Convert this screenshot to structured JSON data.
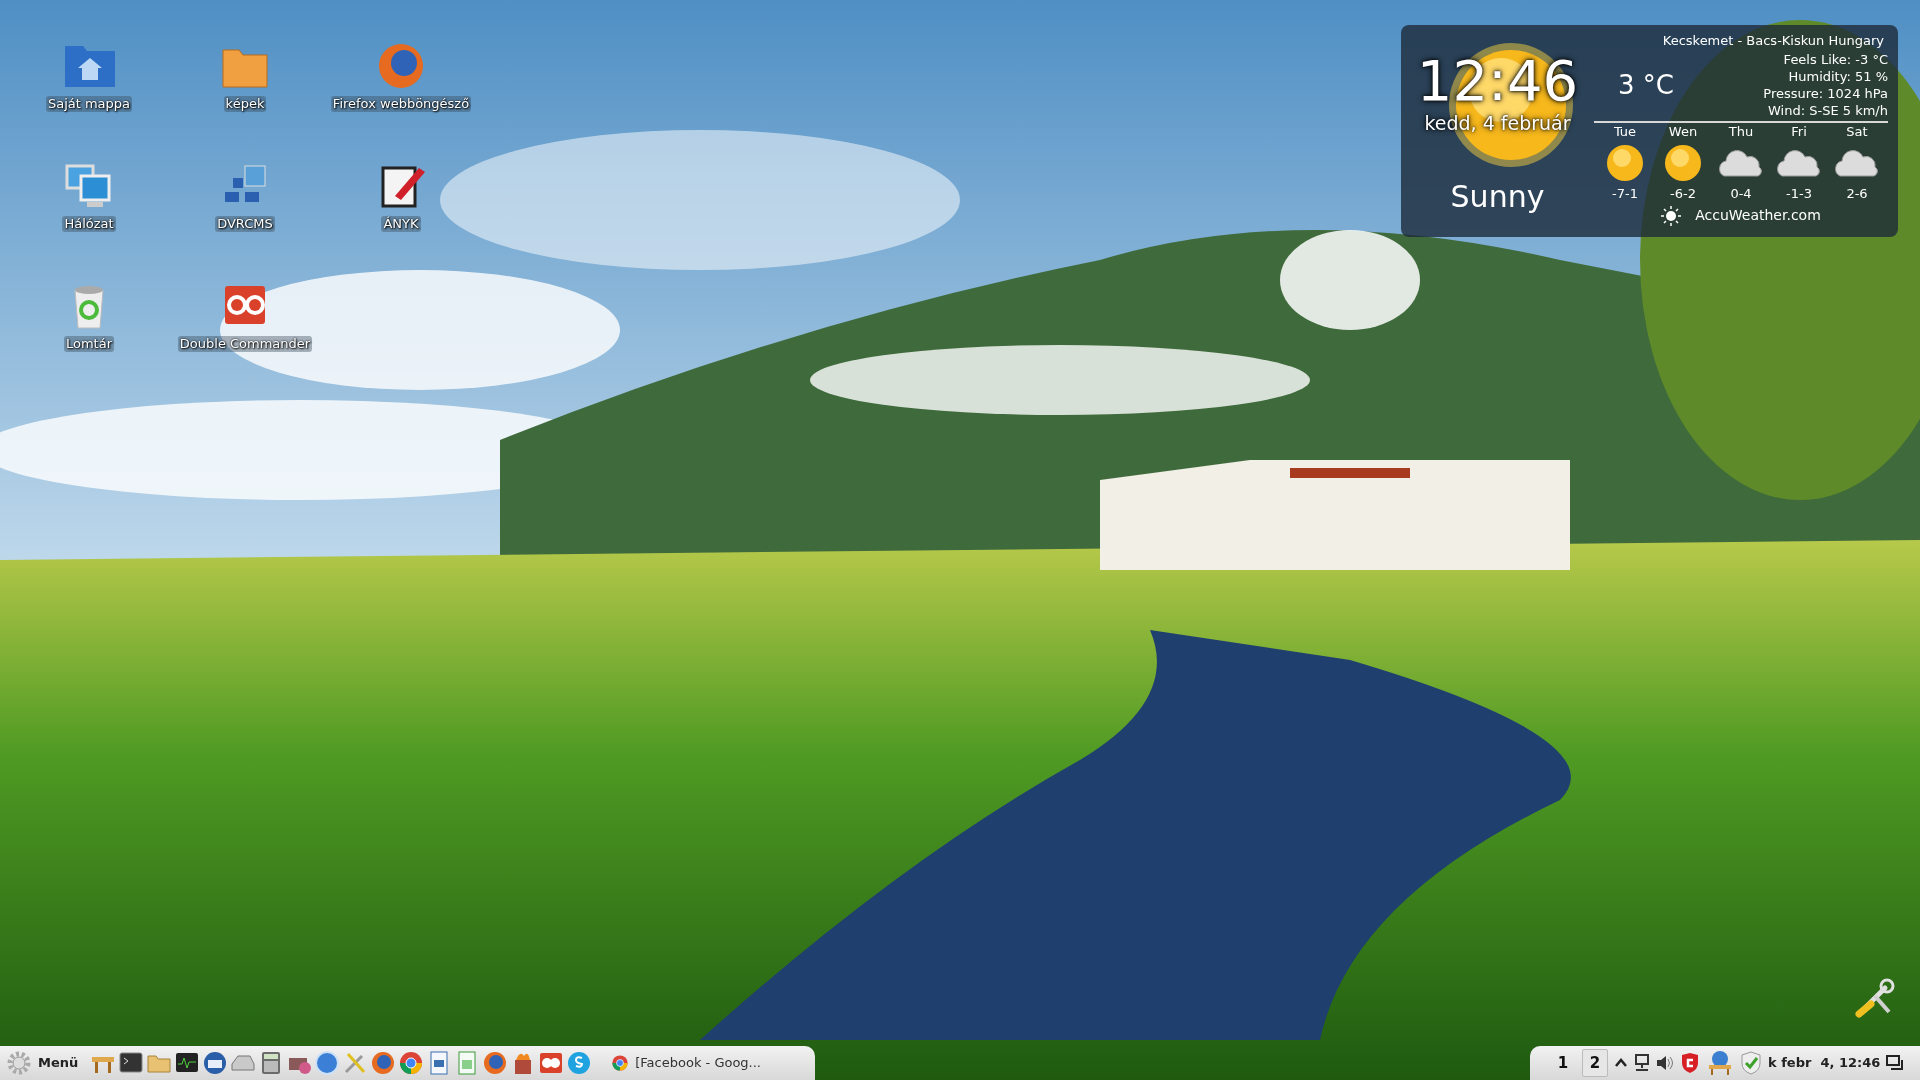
{
  "desktop_icons": [
    {
      "label": "Saját mappa"
    },
    {
      "label": "képek"
    },
    {
      "label": "Firefox webböngésző"
    },
    {
      "label": "Hálózat"
    },
    {
      "label": "DVRCMS"
    },
    {
      "label": "ÁNYK"
    },
    {
      "label": "Lomtár"
    },
    {
      "label": "Double Commander"
    }
  ],
  "weather": {
    "time": "12:46",
    "date": "kedd, 4 február",
    "condition": "Sunny",
    "location": "Kecskemet - Bacs-Kiskun Hungary",
    "temperature": "3 °C",
    "details": [
      "Feels Like: -3 °C",
      "Humidity: 51 %",
      "Pressure: 1024 hPa",
      "Wind: S-SE 5 km/h"
    ],
    "forecast": [
      {
        "day": "Tue",
        "kind": "sun",
        "range": "-7-1"
      },
      {
        "day": "Wen",
        "kind": "sun",
        "range": "-6-2"
      },
      {
        "day": "Thu",
        "kind": "cloud",
        "range": "0-4"
      },
      {
        "day": "Fri",
        "kind": "cloud",
        "range": "-1-3"
      },
      {
        "day": "Sat",
        "kind": "cloud",
        "range": "2-6"
      }
    ],
    "source": "AccuWeather.com"
  },
  "taskbar": {
    "menu_label": "Menü",
    "task": {
      "label": "[Facebook - Goog..."
    },
    "workspaces": [
      {
        "label": "1",
        "selected": false
      },
      {
        "label": "2",
        "selected": true
      }
    ],
    "clock": "k febr  4, 12:46"
  }
}
